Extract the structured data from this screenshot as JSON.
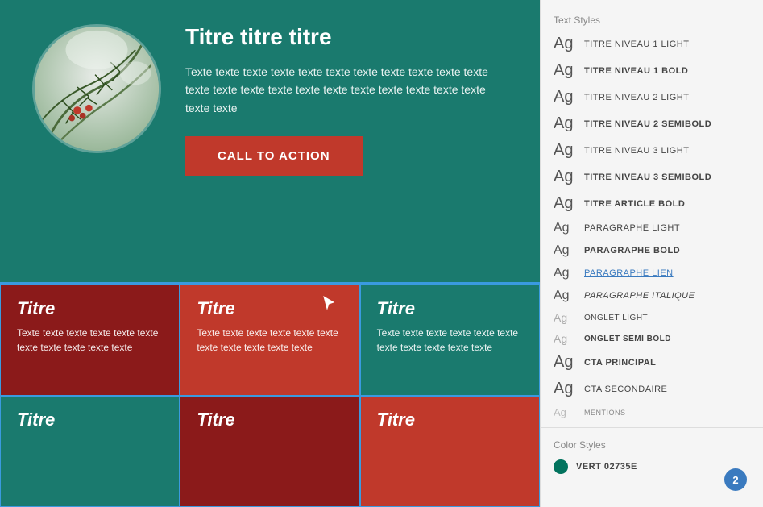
{
  "hero": {
    "title": "Titre titre titre",
    "body": "Texte texte texte texte texte texte texte texte texte texte texte texte texte texte texte texte texte texte texte texte texte texte texte texte",
    "cta_label": "CALL TO ACTION",
    "bg_color": "#1a7a6e"
  },
  "grid": {
    "cells": [
      {
        "title": "Titre",
        "body": "Texte texte texte texte texte texte texte texte texte texte texte",
        "bg": "#8b1a1a"
      },
      {
        "title": "Titre",
        "body": "Texte texte texte texte texte texte texte texte texte texte texte",
        "bg": "#c0392b",
        "has_cursor": true
      },
      {
        "title": "Titre",
        "body": "Texte texte texte texte texte texte texte texte texte texte texte",
        "bg": "#1a7a6e"
      },
      {
        "title": "Titre",
        "body": "",
        "bg": "#1a7a6e"
      },
      {
        "title": "Titre",
        "body": "",
        "bg": "#8b1a1a"
      },
      {
        "title": "Titre",
        "body": "",
        "bg": "#c0392b"
      }
    ]
  },
  "right_panel": {
    "text_styles_heading": "Text Styles",
    "styles": [
      {
        "id": "niveau1-light",
        "ag": "Ag",
        "label": "TITRE NIVEAU 1 LIGHT",
        "class": "style-niveau1-light"
      },
      {
        "id": "niveau1-bold",
        "ag": "Ag",
        "label": "TITRE NIVEAU 1 BOLD",
        "class": "style-niveau1-bold"
      },
      {
        "id": "niveau2-light",
        "ag": "Ag",
        "label": "TITRE NIVEAU 2 LIGHT",
        "class": "style-niveau2-light"
      },
      {
        "id": "niveau2-semibold",
        "ag": "Ag",
        "label": "TITRE NIVEAU 2 SEMIBOLD",
        "class": "style-niveau2-semibold"
      },
      {
        "id": "niveau3-light",
        "ag": "Ag",
        "label": "TITRE NIVEAU 3 LIGHT",
        "class": "style-niveau3-light"
      },
      {
        "id": "niveau3-semibold",
        "ag": "Ag",
        "label": "TITRE NIVEAU 3 SEMIBOLD",
        "class": "style-niveau3-semibold"
      },
      {
        "id": "article-bold",
        "ag": "Ag",
        "label": "TITRE ARTICLE BOLD",
        "class": "style-article-bold"
      },
      {
        "id": "para-light",
        "ag": "Ag",
        "label": "PARAGRAPHE LIGHT",
        "class": "style-para-light"
      },
      {
        "id": "para-bold",
        "ag": "Ag",
        "label": "PARAGRAPHE BOLD",
        "class": "style-para-bold"
      },
      {
        "id": "para-lien",
        "ag": "Ag",
        "label": "PARAGRAPHE LIEN",
        "class": "style-para-lien"
      },
      {
        "id": "para-italic",
        "ag": "Ag",
        "label": "PARAGRAPHE ITALIQUE",
        "class": "style-para-italic"
      },
      {
        "id": "onglet-light",
        "ag": "Ag",
        "label": "ONGLET LIGHT",
        "class": "style-onglet-light"
      },
      {
        "id": "onglet-semi",
        "ag": "Ag",
        "label": "ONGLET SEMI BOLD",
        "class": "style-onglet-semi"
      },
      {
        "id": "cta-principal",
        "ag": "Ag",
        "label": "CTA PRINCIPAL",
        "class": "style-cta-principal"
      },
      {
        "id": "cta-secondaire",
        "ag": "Ag",
        "label": "CTA SECONDAIRE",
        "class": "style-cta-secondaire"
      },
      {
        "id": "mentions",
        "ag": "Ag",
        "label": "MENTIONS",
        "class": "style-mentions"
      }
    ],
    "color_styles_heading": "Color Styles",
    "colors": [
      {
        "id": "vert",
        "label": "VERT 02735E",
        "hex": "#02735e"
      }
    ]
  },
  "notification": {
    "count": "2",
    "color": "#3a7abf"
  }
}
